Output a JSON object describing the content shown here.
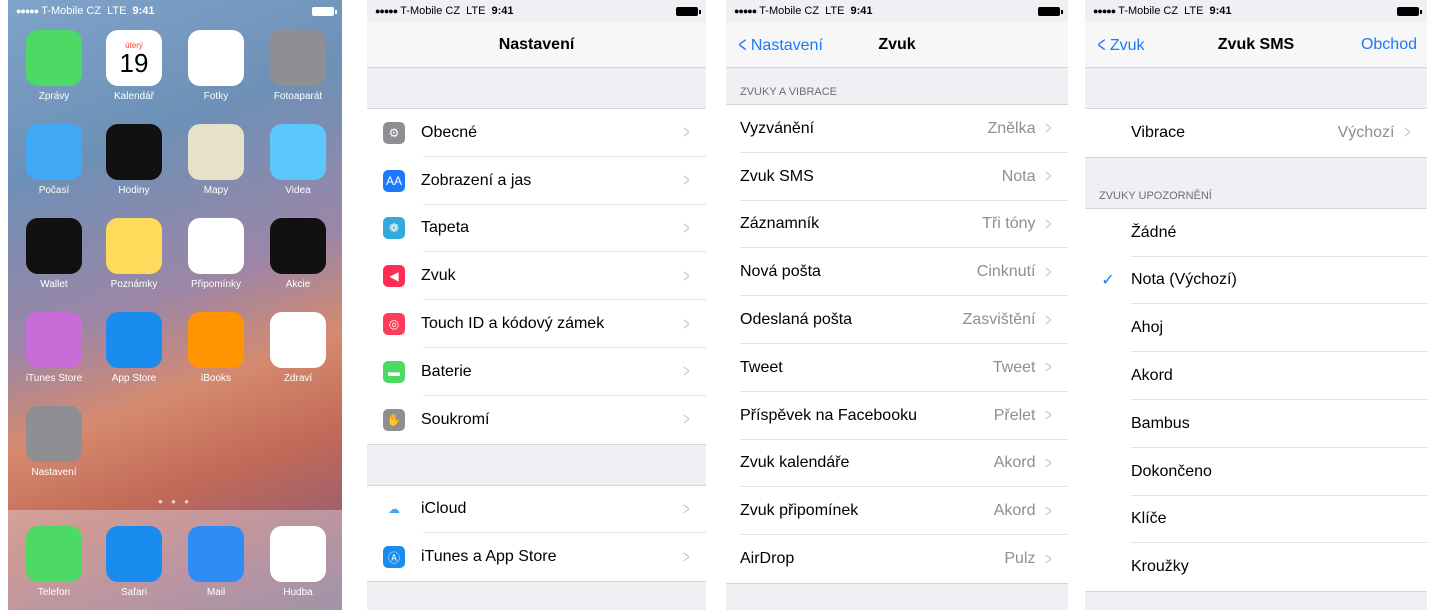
{
  "status": {
    "carrier": "T-Mobile CZ",
    "network": "LTE",
    "time": "9:41"
  },
  "home": {
    "apps": [
      {
        "label": "Zprávy",
        "icon": "messages-icon",
        "color": "#4cd964"
      },
      {
        "label": "Kalendář",
        "icon": "calendar-icon",
        "color": "#ffffff",
        "day_name": "úterý",
        "day_num": "19"
      },
      {
        "label": "Fotky",
        "icon": "photos-icon",
        "color": "#ffffff"
      },
      {
        "label": "Fotoaparát",
        "icon": "camera-icon",
        "color": "#8e8e93"
      },
      {
        "label": "Počasí",
        "icon": "weather-icon",
        "color": "#3fa9f5"
      },
      {
        "label": "Hodiny",
        "icon": "clock-icon",
        "color": "#111111"
      },
      {
        "label": "Mapy",
        "icon": "maps-icon",
        "color": "#e8e1c9"
      },
      {
        "label": "Videa",
        "icon": "videos-icon",
        "color": "#5ac8fa"
      },
      {
        "label": "Wallet",
        "icon": "wallet-icon",
        "color": "#111111"
      },
      {
        "label": "Poznámky",
        "icon": "notes-icon",
        "color": "#fedb5a"
      },
      {
        "label": "Připomínky",
        "icon": "reminders-icon",
        "color": "#ffffff"
      },
      {
        "label": "Akcie",
        "icon": "stocks-icon",
        "color": "#111111"
      },
      {
        "label": "iTunes Store",
        "icon": "itunes-store-icon",
        "color": "#c86dd7"
      },
      {
        "label": "App Store",
        "icon": "app-store-icon",
        "color": "#1a8cf0"
      },
      {
        "label": "iBooks",
        "icon": "ibooks-icon",
        "color": "#ff9500"
      },
      {
        "label": "Zdraví",
        "icon": "health-icon",
        "color": "#ffffff"
      },
      {
        "label": "Nastavení",
        "icon": "settings-icon",
        "color": "#8e8e93"
      }
    ],
    "dock": [
      {
        "label": "Telefon",
        "icon": "phone-icon",
        "color": "#4cd964"
      },
      {
        "label": "Safari",
        "icon": "safari-icon",
        "color": "#1a8cf0"
      },
      {
        "label": "Mail",
        "icon": "mail-icon",
        "color": "#2d8cf5"
      },
      {
        "label": "Hudba",
        "icon": "music-icon",
        "color": "#ffffff"
      }
    ]
  },
  "settings": {
    "title": "Nastavení",
    "group1": [
      {
        "label": "Obecné",
        "icon": "gear-icon",
        "color": "#8e8e93",
        "glyph": "⚙"
      },
      {
        "label": "Zobrazení a jas",
        "icon": "display-brightness-icon",
        "color": "#1a7afb",
        "glyph": "AA"
      },
      {
        "label": "Tapeta",
        "icon": "wallpaper-icon",
        "color": "#34aadc",
        "glyph": "❁"
      },
      {
        "label": "Zvuk",
        "icon": "sound-icon",
        "color": "#ff2d55",
        "glyph": "◀"
      },
      {
        "label": "Touch ID a kódový zámek",
        "icon": "fingerprint-icon",
        "color": "#ff3b5c",
        "glyph": "◎"
      },
      {
        "label": "Baterie",
        "icon": "battery-icon",
        "color": "#4cd964",
        "glyph": "▬"
      },
      {
        "label": "Soukromí",
        "icon": "hand-icon",
        "color": "#8e8e93",
        "glyph": "✋"
      }
    ],
    "group2": [
      {
        "label": "iCloud",
        "icon": "icloud-icon",
        "color": "#ffffff",
        "glyph": "☁"
      },
      {
        "label": "iTunes a App Store",
        "icon": "app-store-icon",
        "color": "#1a8cf0",
        "glyph": "Ⓐ"
      }
    ]
  },
  "sound": {
    "back": "Nastavení",
    "title": "Zvuk",
    "section": "ZVUKY A VIBRACE",
    "rows": [
      {
        "label": "Vyzvánění",
        "value": "Znělka"
      },
      {
        "label": "Zvuk SMS",
        "value": "Nota"
      },
      {
        "label": "Záznamník",
        "value": "Tři tóny"
      },
      {
        "label": "Nová pošta",
        "value": "Cinknutí"
      },
      {
        "label": "Odeslaná pošta",
        "value": "Zasvištění"
      },
      {
        "label": "Tweet",
        "value": "Tweet"
      },
      {
        "label": "Příspěvek na Facebooku",
        "value": "Přelet"
      },
      {
        "label": "Zvuk kalendáře",
        "value": "Akord"
      },
      {
        "label": "Zvuk připomínek",
        "value": "Akord"
      },
      {
        "label": "AirDrop",
        "value": "Pulz"
      }
    ]
  },
  "sms": {
    "back": "Zvuk",
    "title": "Zvuk SMS",
    "right": "Obchod",
    "vibrace_label": "Vibrace",
    "vibrace_value": "Výchozí",
    "section": "ZVUKY UPOZORNĚNÍ",
    "tones": [
      {
        "label": "Žádné",
        "checked": false
      },
      {
        "label": "Nota (Výchozí)",
        "checked": true
      },
      {
        "label": "Ahoj",
        "checked": false
      },
      {
        "label": "Akord",
        "checked": false
      },
      {
        "label": "Bambus",
        "checked": false
      },
      {
        "label": "Dokončeno",
        "checked": false
      },
      {
        "label": "Klíče",
        "checked": false
      },
      {
        "label": "Kroužky",
        "checked": false
      }
    ]
  }
}
